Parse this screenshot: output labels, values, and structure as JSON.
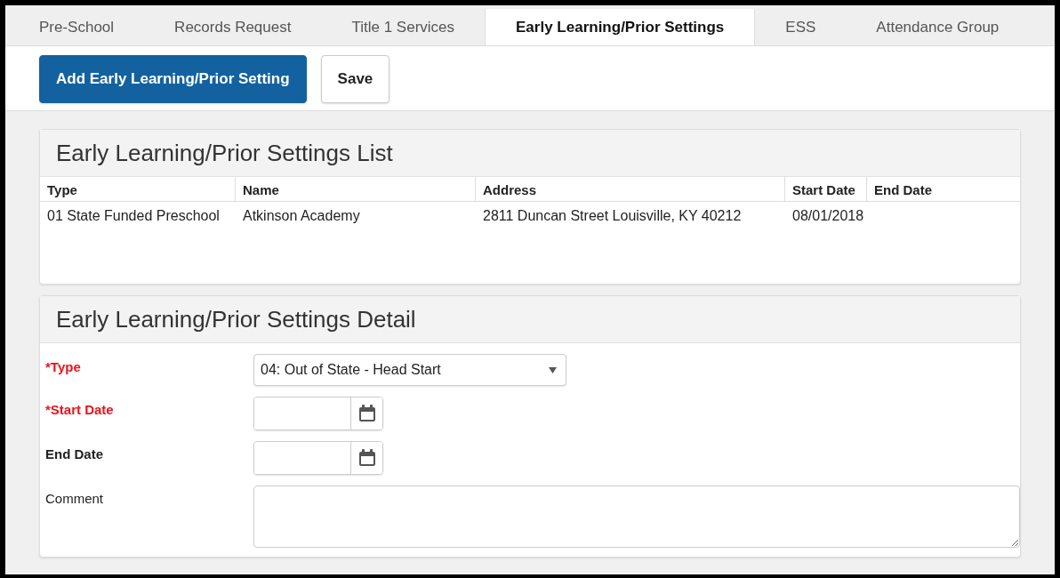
{
  "tabs": [
    {
      "label": "Pre-School",
      "selected": false
    },
    {
      "label": "Records Request",
      "selected": false
    },
    {
      "label": "Title 1 Services",
      "selected": false
    },
    {
      "label": "Early Learning/Prior Settings",
      "selected": true
    },
    {
      "label": "ESS",
      "selected": false
    },
    {
      "label": "Attendance Group",
      "selected": false
    }
  ],
  "toolbar": {
    "buttons": [
      {
        "label": "Add Early Learning/Prior Setting",
        "kind": "primary"
      },
      {
        "label": "Save",
        "kind": "secondary"
      }
    ]
  },
  "list_panel": {
    "title": "Early Learning/Prior Settings List",
    "table": {
      "columns": [
        "Type",
        "Name",
        "Address",
        "Start Date",
        "End Date"
      ],
      "rows": [
        [
          "01 State Funded Preschool",
          "Atkinson Academy",
          "2811 Duncan Street Louisville, KY 40212",
          "08/01/2018",
          ""
        ]
      ]
    }
  },
  "detail_panel": {
    "title": "Early Learning/Prior Settings Detail",
    "fields": [
      {
        "label": "*Type",
        "kind": "select",
        "required": true,
        "value": "04: Out of State - Head Start"
      },
      {
        "label": "*Start Date",
        "kind": "date",
        "required": true
      },
      {
        "label": "End Date",
        "kind": "date",
        "required": false
      },
      {
        "label": "Comment",
        "kind": "textarea",
        "required": false
      }
    ]
  }
}
